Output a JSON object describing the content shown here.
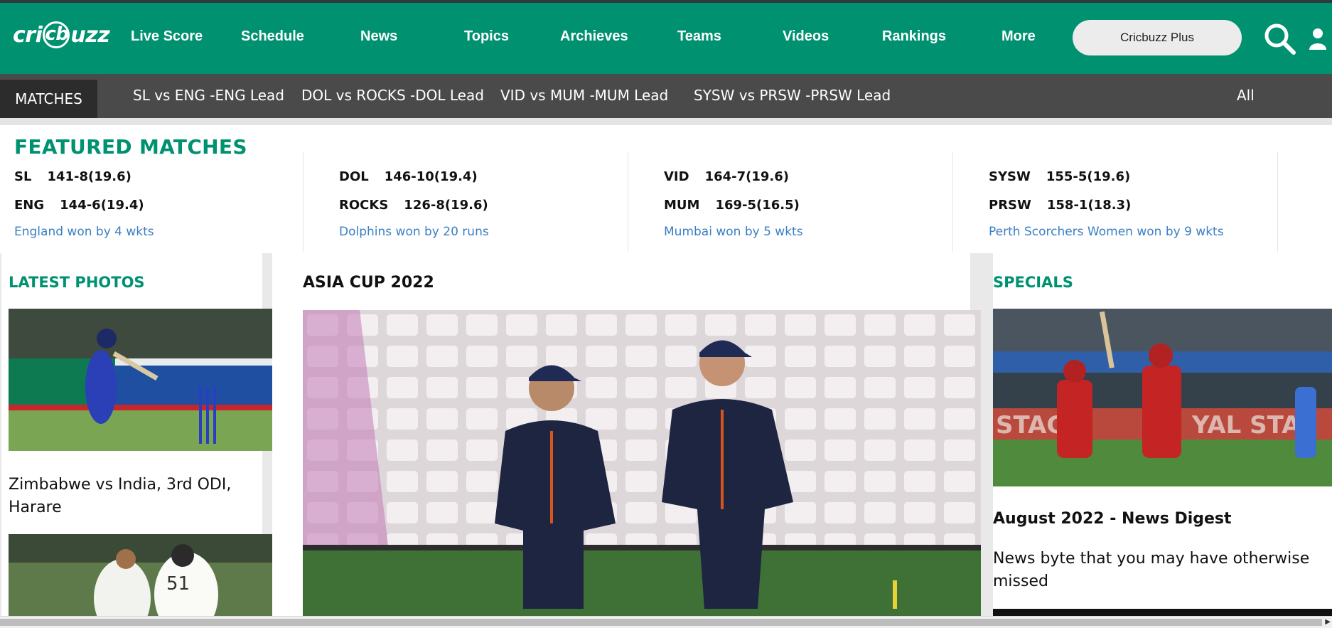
{
  "brand": {
    "logo_text_pre": "cri",
    "logo_text_circle": "cb",
    "logo_text_post": "uzz",
    "accent": "#009270",
    "link_color": "#3b7fc4"
  },
  "nav": {
    "items": [
      {
        "label": "Live Score"
      },
      {
        "label": "Schedule"
      },
      {
        "label": "News"
      },
      {
        "label": "Topics"
      },
      {
        "label": "Archieves"
      },
      {
        "label": "Teams"
      },
      {
        "label": "Videos"
      },
      {
        "label": "Rankings"
      },
      {
        "label": "More"
      }
    ],
    "plus_label": "Cricbuzz Plus",
    "search_icon": "search-icon",
    "user_icon": "user-icon"
  },
  "matchbar": {
    "tab_label": "MATCHES",
    "links": [
      {
        "label": "SL vs ENG -ENG Lead"
      },
      {
        "label": "DOL vs ROCKS -DOL Lead"
      },
      {
        "label": "VID vs MUM -MUM Lead"
      },
      {
        "label": "SYSW vs PRSW -PRSW Lead"
      }
    ],
    "all_label": "All"
  },
  "featured": {
    "title": "FEATURED MATCHES",
    "cards": [
      {
        "team1": "SL",
        "score1": "141-8(19.6)",
        "team2": "ENG",
        "score2": "144-6(19.4)",
        "result": "England won by 4 wkts"
      },
      {
        "team1": "DOL",
        "score1": "146-10(19.4)",
        "team2": "ROCKS",
        "score2": "126-8(19.6)",
        "result": "Dolphins won by 20 runs"
      },
      {
        "team1": "VID",
        "score1": "164-7(19.6)",
        "team2": "MUM",
        "score2": "169-5(16.5)",
        "result": "Mumbai won by 5 wkts"
      },
      {
        "team1": "SYSW",
        "score1": "155-5(19.6)",
        "team2": "PRSW",
        "score2": "158-1(18.3)",
        "result": "Perth Scorchers Women won by 9 wkts"
      }
    ]
  },
  "latest_photos": {
    "title": "LATEST PHOTOS",
    "items": [
      {
        "caption": "Zimbabwe vs India, 3rd ODI, Harare"
      }
    ]
  },
  "main": {
    "title": "ASIA CUP 2022"
  },
  "specials": {
    "title": "SPECIALS",
    "headline": "August 2022 - News Digest",
    "subtitle": "News byte that you may have otherwise missed"
  }
}
